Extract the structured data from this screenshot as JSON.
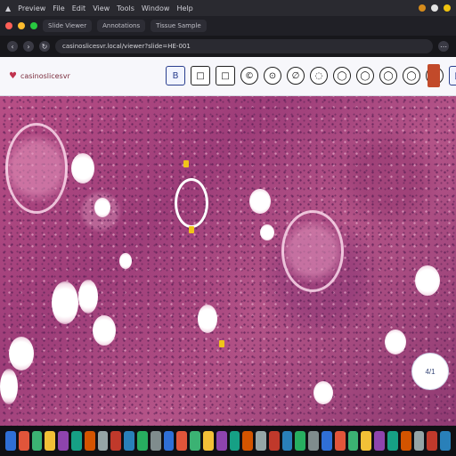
{
  "menubar": {
    "items": [
      "Preview",
      "File",
      "Edit",
      "View",
      "Tools",
      "Window",
      "Help"
    ],
    "status": [
      "Wi‑Fi",
      "Battery",
      "Clock"
    ]
  },
  "browser": {
    "tabs": [
      {
        "label": "Slide Viewer"
      },
      {
        "label": "Annotations"
      },
      {
        "label": "Tissue Sample"
      }
    ],
    "address": "casinoslicesvr.local/viewer?slide=HE-001"
  },
  "app": {
    "brand": "casinoslicesvr",
    "tools": [
      "B",
      "□",
      "□",
      "©",
      "⊙",
      "∅",
      "◌",
      "◯",
      "◯",
      "◯",
      "◯",
      "◯",
      "◯",
      "◯",
      "◯",
      "▣"
    ]
  },
  "viewer": {
    "zoom_label": "4/1"
  },
  "dock": {
    "icons": 34
  },
  "colors": {
    "tissue_primary": "#b84f86",
    "tissue_dark": "#5a1f55",
    "accent_marker": "#f0c419",
    "brand": "#c0334e"
  }
}
